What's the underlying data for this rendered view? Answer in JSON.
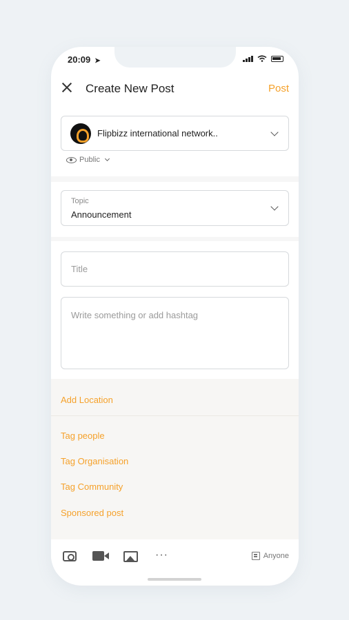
{
  "status_bar": {
    "time": "20:09"
  },
  "header": {
    "title": "Create New Post",
    "post_label": "Post"
  },
  "organisation": {
    "name": "Flipbizz international network..",
    "visibility": "Public"
  },
  "topic": {
    "label": "Topic",
    "value": "Announcement"
  },
  "form": {
    "title_placeholder": "Title",
    "body_placeholder": "Write something or add hashtag"
  },
  "options": {
    "add_location": "Add Location",
    "tag_people": "Tag people",
    "tag_organisation": "Tag Organisation",
    "tag_community": "Tag Community",
    "sponsored_post": "Sponsored post"
  },
  "toolbar": {
    "audience_label": "Anyone",
    "more_glyph": "···"
  },
  "colors": {
    "accent": "#f5a12a",
    "background": "#eef2f5"
  },
  "icons": [
    "close-icon",
    "chevron-down-icon",
    "eye-icon",
    "camera-icon",
    "video-icon",
    "image-icon",
    "more-icon",
    "audience-icon"
  ]
}
